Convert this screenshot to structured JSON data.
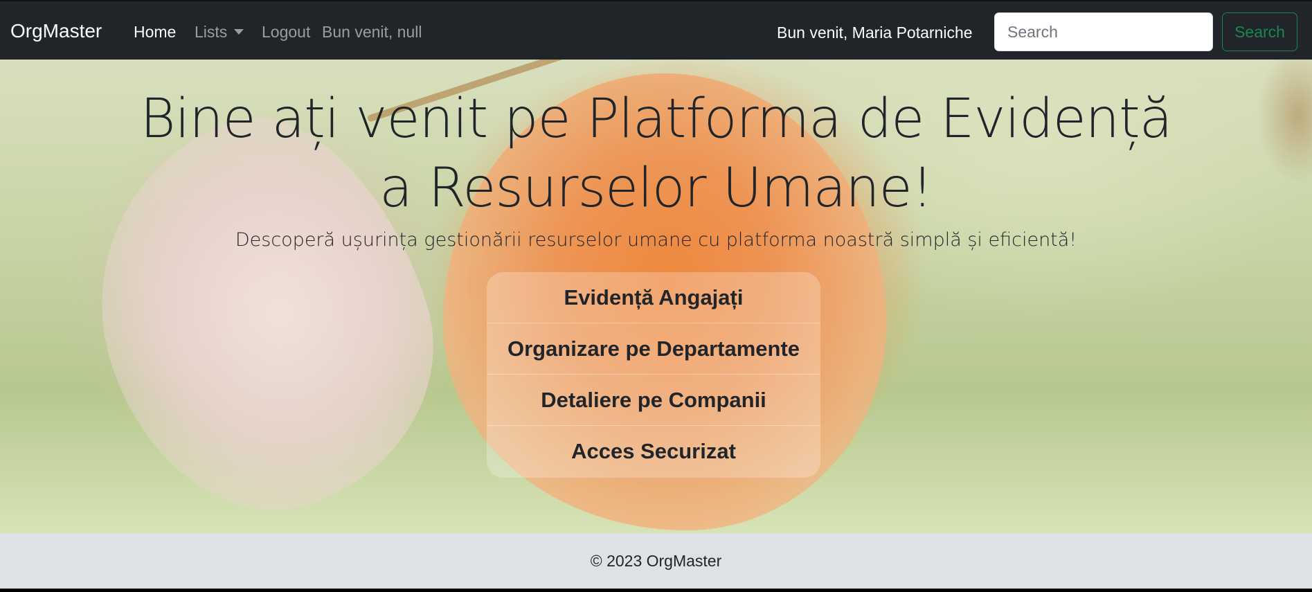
{
  "navbar": {
    "brand": "OrgMaster",
    "links": {
      "home": "Home",
      "lists": "Lists",
      "logout": "Logout",
      "welcome_null": "Bun venit, null"
    },
    "welcome_user": "Bun venit, Maria Potarniche",
    "search": {
      "placeholder": "Search",
      "button_label": "Search"
    }
  },
  "hero": {
    "title": "Bine ați venit pe Platforma de Evidență a Resurselor Umane!",
    "subtitle": "Descoperă ușurința gestionării resurselor umane cu platforma noastră simplă și eficientă!",
    "features": [
      "Evidență Angajați",
      "Organizare pe Departamente",
      "Detaliere pe Companii",
      "Acces Securizat"
    ]
  },
  "footer": {
    "text": "© 2023 OrgMaster"
  },
  "colors": {
    "navbar_bg": "#212529",
    "search_button": "#198754",
    "footer_bg": "#dee2e6"
  }
}
